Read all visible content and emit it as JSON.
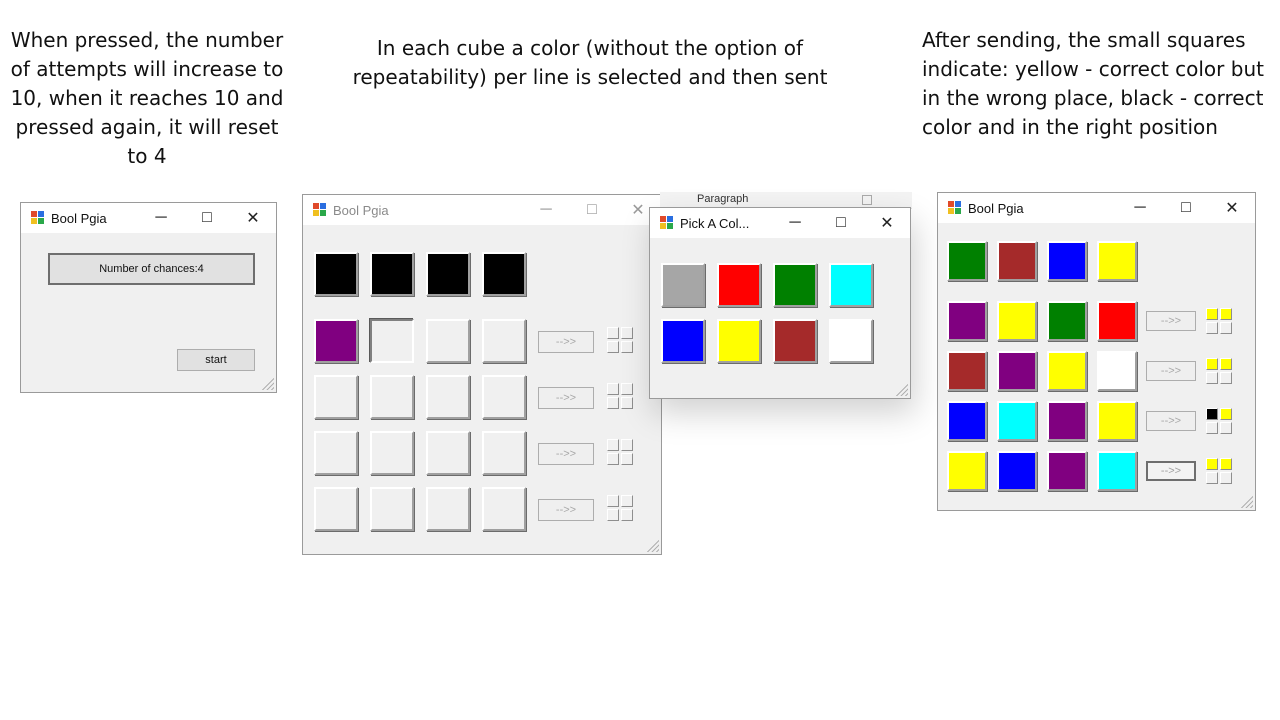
{
  "captions": {
    "left": "When pressed, the number of attempts will increase to 10, when it reaches 10 and pressed again, it will reset to 4",
    "middle": "In each cube a color (without the option of repeatability) per line is selected and then sent",
    "right": "After sending, the small squares indicate: yellow - correct color but in the wrong place, black - correct color and in the right position"
  },
  "window_controls": {
    "minimize": "─",
    "maximize": "□",
    "close": "✕"
  },
  "colors": {
    "black": "#000000",
    "gray": "#a6a6a6",
    "red": "#ff0000",
    "green": "#008000",
    "cyan": "#00ffff",
    "blue": "#0000ff",
    "yellow": "#ffff00",
    "brown": "#a52a2a",
    "white": "#ffffff",
    "purple": "#800080",
    "empty": "#f0f0f0"
  },
  "start_window": {
    "title": "Bool Pgia",
    "chances_button": "Number of chances:4",
    "start_button": "start"
  },
  "game_window": {
    "title": "Bool Pgia",
    "secret_row": [
      "black",
      "black",
      "black",
      "black"
    ],
    "guess_rows": [
      {
        "cells": [
          "purple",
          "selected",
          "empty",
          "empty"
        ],
        "send_label": "-->>",
        "feedback": [
          "empty",
          "empty",
          "empty",
          "empty"
        ]
      },
      {
        "cells": [
          "empty",
          "empty",
          "empty",
          "empty"
        ],
        "send_label": "-->>",
        "feedback": [
          "empty",
          "empty",
          "empty",
          "empty"
        ]
      },
      {
        "cells": [
          "empty",
          "empty",
          "empty",
          "empty"
        ],
        "send_label": "-->>",
        "feedback": [
          "empty",
          "empty",
          "empty",
          "empty"
        ]
      },
      {
        "cells": [
          "empty",
          "empty",
          "empty",
          "empty"
        ],
        "send_label": "-->>",
        "feedback": [
          "empty",
          "empty",
          "empty",
          "empty"
        ]
      }
    ]
  },
  "ribbon": {
    "label": "Paragraph"
  },
  "picker_window": {
    "title": "Pick A Col...",
    "colors": [
      "gray",
      "red",
      "green",
      "cyan",
      "blue",
      "yellow",
      "brown",
      "white"
    ]
  },
  "result_window": {
    "title": "Bool Pgia",
    "secret_row": [
      "green",
      "brown",
      "blue",
      "yellow"
    ],
    "guess_rows": [
      {
        "cells": [
          "purple",
          "yellow",
          "green",
          "red"
        ],
        "send_label": "-->>",
        "feedback": [
          "yellow",
          "yellow",
          "empty",
          "empty"
        ]
      },
      {
        "cells": [
          "brown",
          "purple",
          "yellow",
          "white"
        ],
        "send_label": "-->>",
        "feedback": [
          "yellow",
          "yellow",
          "empty",
          "empty"
        ]
      },
      {
        "cells": [
          "blue",
          "cyan",
          "purple",
          "yellow"
        ],
        "send_label": "-->>",
        "feedback": [
          "black",
          "yellow",
          "empty",
          "empty"
        ]
      },
      {
        "cells": [
          "yellow",
          "blue",
          "purple",
          "cyan"
        ],
        "send_label": "-->>",
        "feedback": [
          "yellow",
          "yellow",
          "empty",
          "empty"
        ]
      }
    ]
  }
}
